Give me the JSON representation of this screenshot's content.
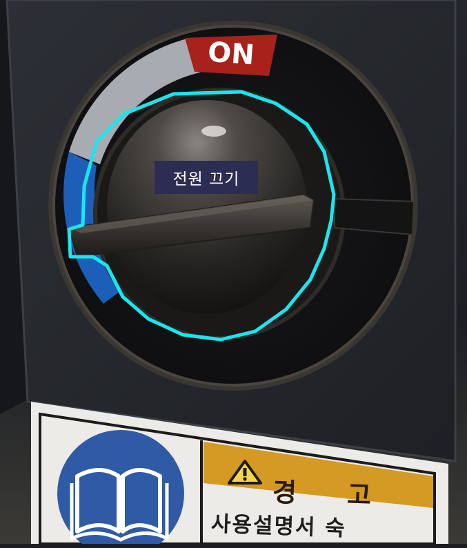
{
  "switch": {
    "on_label": "ON",
    "tooltip": "전원 끄기",
    "highlight_color": "#19e6ee",
    "on_color": "#a8211a",
    "off_color": "#1d5fb8"
  },
  "warning_label": {
    "title": "경 고",
    "body": "사용설명서 숙",
    "header_color": "#d49a24",
    "icon_bg_color": "#2f5aa6"
  },
  "icons": {
    "warning": "warning-triangle-icon",
    "manual": "open-book-icon"
  }
}
